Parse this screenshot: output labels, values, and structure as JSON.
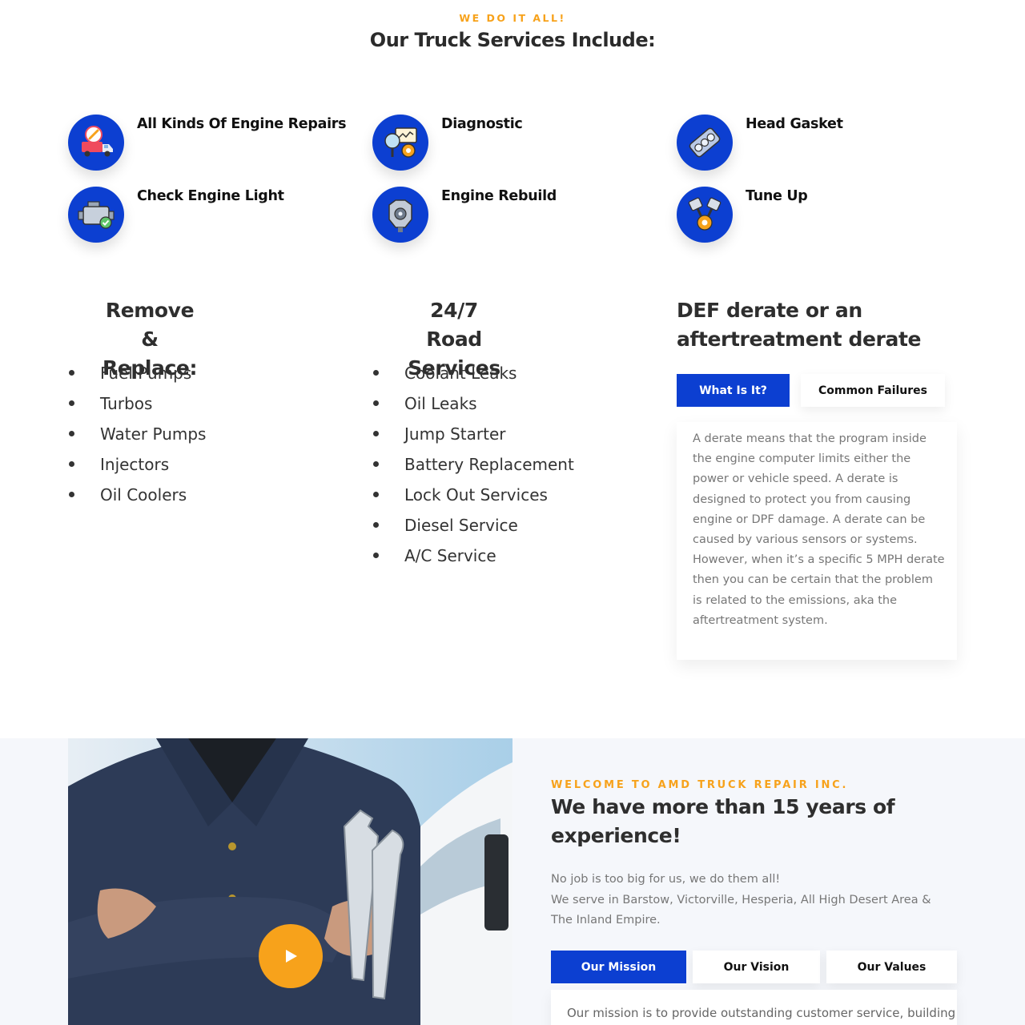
{
  "header": {
    "eyebrow": "WE DO IT ALL!",
    "title": "Our Truck Services Include:"
  },
  "services": [
    {
      "label": "All Kinds Of Engine Repairs",
      "icon": "truck-wrench-icon"
    },
    {
      "label": "Diagnostic",
      "icon": "diagnostic-gear-icon"
    },
    {
      "label": "Head Gasket",
      "icon": "head-gasket-icon"
    },
    {
      "label": "Check Engine Light",
      "icon": "engine-check-icon"
    },
    {
      "label": "Engine Rebuild",
      "icon": "engine-rebuild-icon"
    },
    {
      "label": "Tune Up",
      "icon": "piston-icon"
    }
  ],
  "remove_replace": {
    "line1": "Remove &",
    "line2": "Replace:",
    "items": [
      "Fuel Pumps",
      "Turbos",
      "Water Pumps",
      "Injectors",
      "Oil Coolers"
    ]
  },
  "road_services": {
    "line1": "24/7 Road",
    "line2": "Services",
    "items": [
      "Coolant Leaks",
      "Oil Leaks",
      "Jump Starter",
      "Battery Replacement",
      "Lock Out Services",
      "Diesel Service",
      "A/C Service"
    ]
  },
  "def": {
    "line1": "DEF derate or an",
    "line2": "aftertreatment derate",
    "tabs": [
      "What Is It?",
      "Common Failures"
    ],
    "active_tab": "What Is It?",
    "content": "A derate means that the program inside the engine computer limits either the power or vehicle speed. A derate is designed to protect you from causing engine or DPF damage. A derate can be caused by various sensors or systems. However, when it’s a specific 5 MPH derate then you can be certain that the problem is related to the emissions, aka the aftertreatment system."
  },
  "welcome": {
    "eyebrow": "WELCOME TO AMD TRUCK REPAIR INC.",
    "title_line1": "We have more than 15 years of",
    "title_line2": "experience!",
    "body_line1": "No job is too big for us, we do them all!",
    "body_line2": "We serve in Barstow, Victorville, Hesperia, All High Desert Area & The Inland Empire.",
    "tabs": [
      "Our Mission",
      "Our Vision",
      "Our Values"
    ],
    "active_tab": "Our Mission",
    "mission_text": "Our mission is to provide outstanding customer service, building"
  },
  "colors": {
    "accent": "#f7a21b",
    "primary": "#0c3fd1",
    "band_bg": "#f5f7fb"
  }
}
